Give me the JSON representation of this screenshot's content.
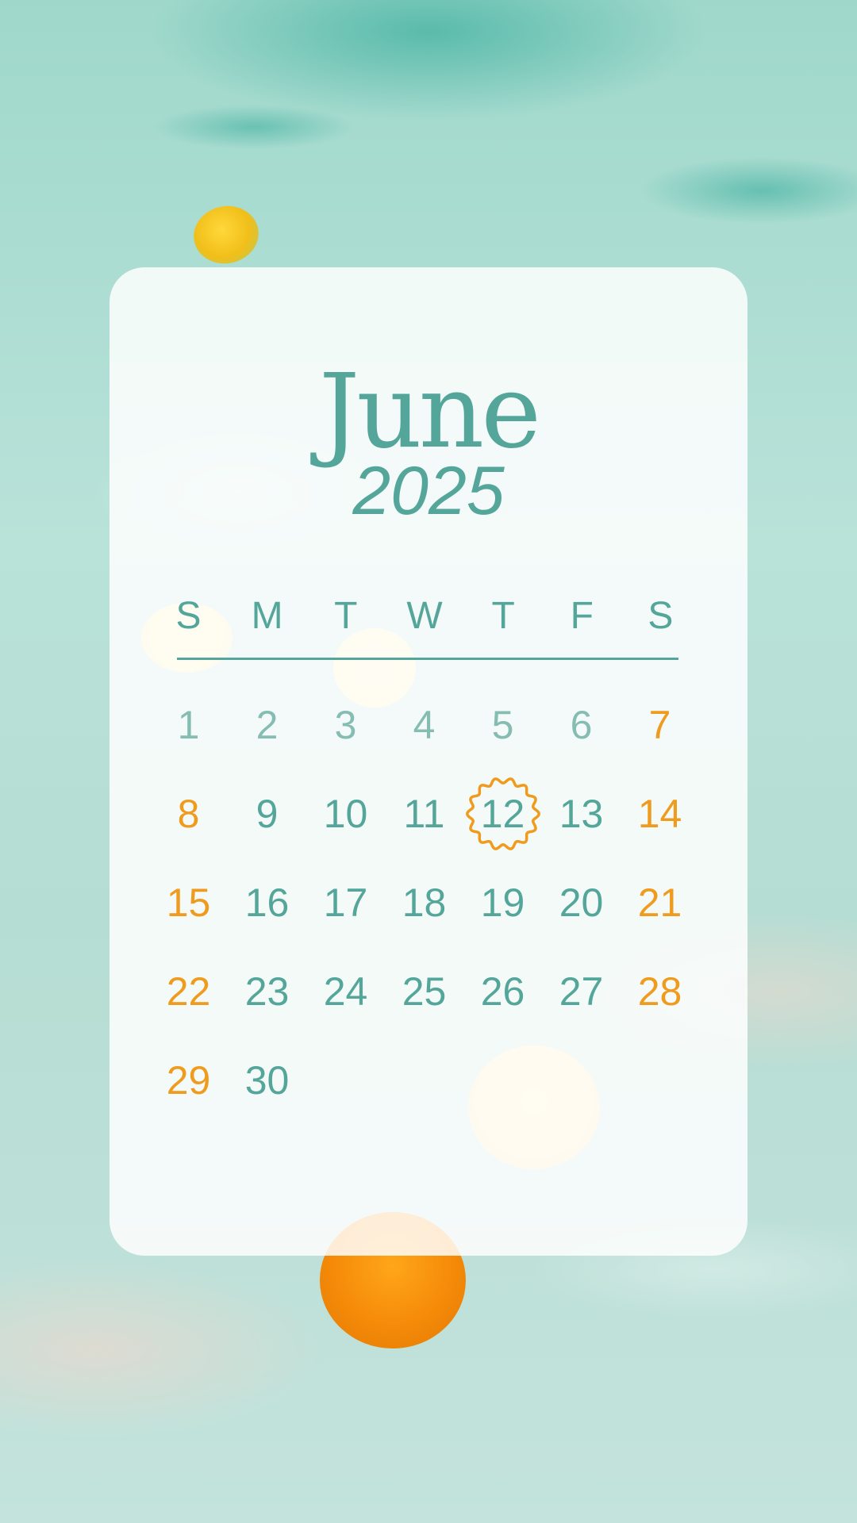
{
  "calendar": {
    "month": "June",
    "year": "2025",
    "weekdays": [
      "S",
      "M",
      "T",
      "W",
      "T",
      "F",
      "S"
    ],
    "weeks": [
      [
        "1",
        "2",
        "3",
        "4",
        "5",
        "6",
        "7"
      ],
      [
        "8",
        "9",
        "10",
        "11",
        "12",
        "13",
        "14"
      ],
      [
        "15",
        "16",
        "17",
        "18",
        "19",
        "20",
        "21"
      ],
      [
        "22",
        "23",
        "24",
        "25",
        "26",
        "27",
        "28"
      ],
      [
        "29",
        "30",
        "",
        "",
        "",
        "",
        ""
      ]
    ],
    "highlighted_day": "12"
  },
  "colors": {
    "teal_text": "#55a69a",
    "weekend_orange": "#ef9b1e",
    "card_background": "#ffffff"
  },
  "icons": {
    "highlight_badge": "scalloped-circle-icon"
  }
}
